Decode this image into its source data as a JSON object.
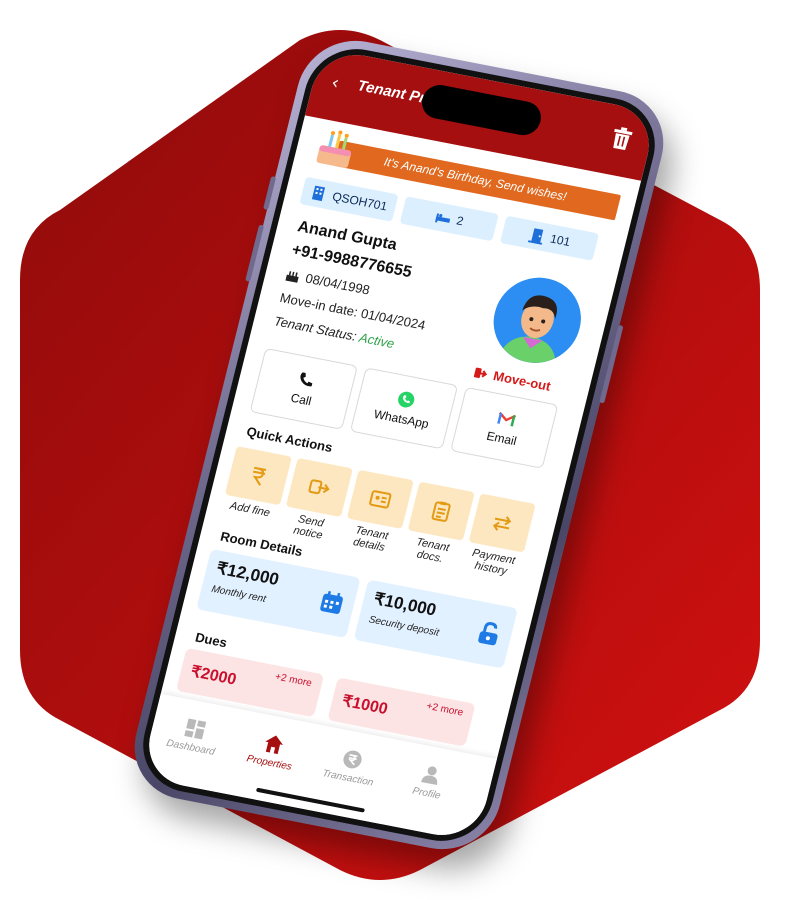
{
  "colors": {
    "brand_red": "#a50f0f",
    "bg_red": "#c21010",
    "banner_orange": "#e0691f",
    "active_green": "#2ea24a",
    "chip_blue": "#dcefff",
    "qa_amber": "#fde7c0"
  },
  "header": {
    "title": "Tenant Profile",
    "back_icon": "chevron-left-icon",
    "delete_icon": "trash-icon"
  },
  "birthday_banner": {
    "text": "It's Anand's Birthday, Send wishes!",
    "icon": "cake-icon"
  },
  "chips": [
    {
      "icon": "building-icon",
      "label": "QSOH701"
    },
    {
      "icon": "bed-icon",
      "label": "2"
    },
    {
      "icon": "door-icon",
      "label": "101"
    }
  ],
  "tenant": {
    "name": "Anand Gupta",
    "phone": "+91-9988776655",
    "dob": "08/04/1998",
    "move_in": "Move-in date: 01/04/2024",
    "status_label": "Tenant Status: ",
    "status_value": "Active",
    "moveout_label": "Move-out"
  },
  "contacts": [
    {
      "icon": "phone-icon",
      "label": "Call"
    },
    {
      "icon": "whatsapp-icon",
      "label": "WhatsApp"
    },
    {
      "icon": "gmail-icon",
      "label": "Email"
    }
  ],
  "quick_actions": {
    "title": "Quick Actions",
    "items": [
      {
        "icon": "rupee-icon",
        "label": "Add fine"
      },
      {
        "icon": "send-icon",
        "label": "Send notice"
      },
      {
        "icon": "id-card-icon",
        "label": "Tenant details"
      },
      {
        "icon": "clipboard-icon",
        "label": "Tenant docs."
      },
      {
        "icon": "swap-icon",
        "label": "Payment history"
      }
    ]
  },
  "room_details": {
    "title": "Room Details",
    "monthly_rent": {
      "amount": "₹12,000",
      "label": "Monthly rent",
      "icon": "calendar-icon"
    },
    "security_deposit": {
      "amount": "₹10,000",
      "label": "Security deposit",
      "icon": "unlock-icon"
    }
  },
  "dues": {
    "title": "Dues",
    "items": [
      {
        "amount": "₹2000",
        "more": "+2 more"
      },
      {
        "amount": "₹1000",
        "more": "+2 more"
      }
    ]
  },
  "bottom_nav": [
    {
      "icon": "dashboard-icon",
      "label": "Dashboard",
      "active": false
    },
    {
      "icon": "home-icon",
      "label": "Properties",
      "active": true
    },
    {
      "icon": "rupee-coin-icon",
      "label": "Transaction",
      "active": false
    },
    {
      "icon": "person-icon",
      "label": "Profile",
      "active": false
    }
  ]
}
